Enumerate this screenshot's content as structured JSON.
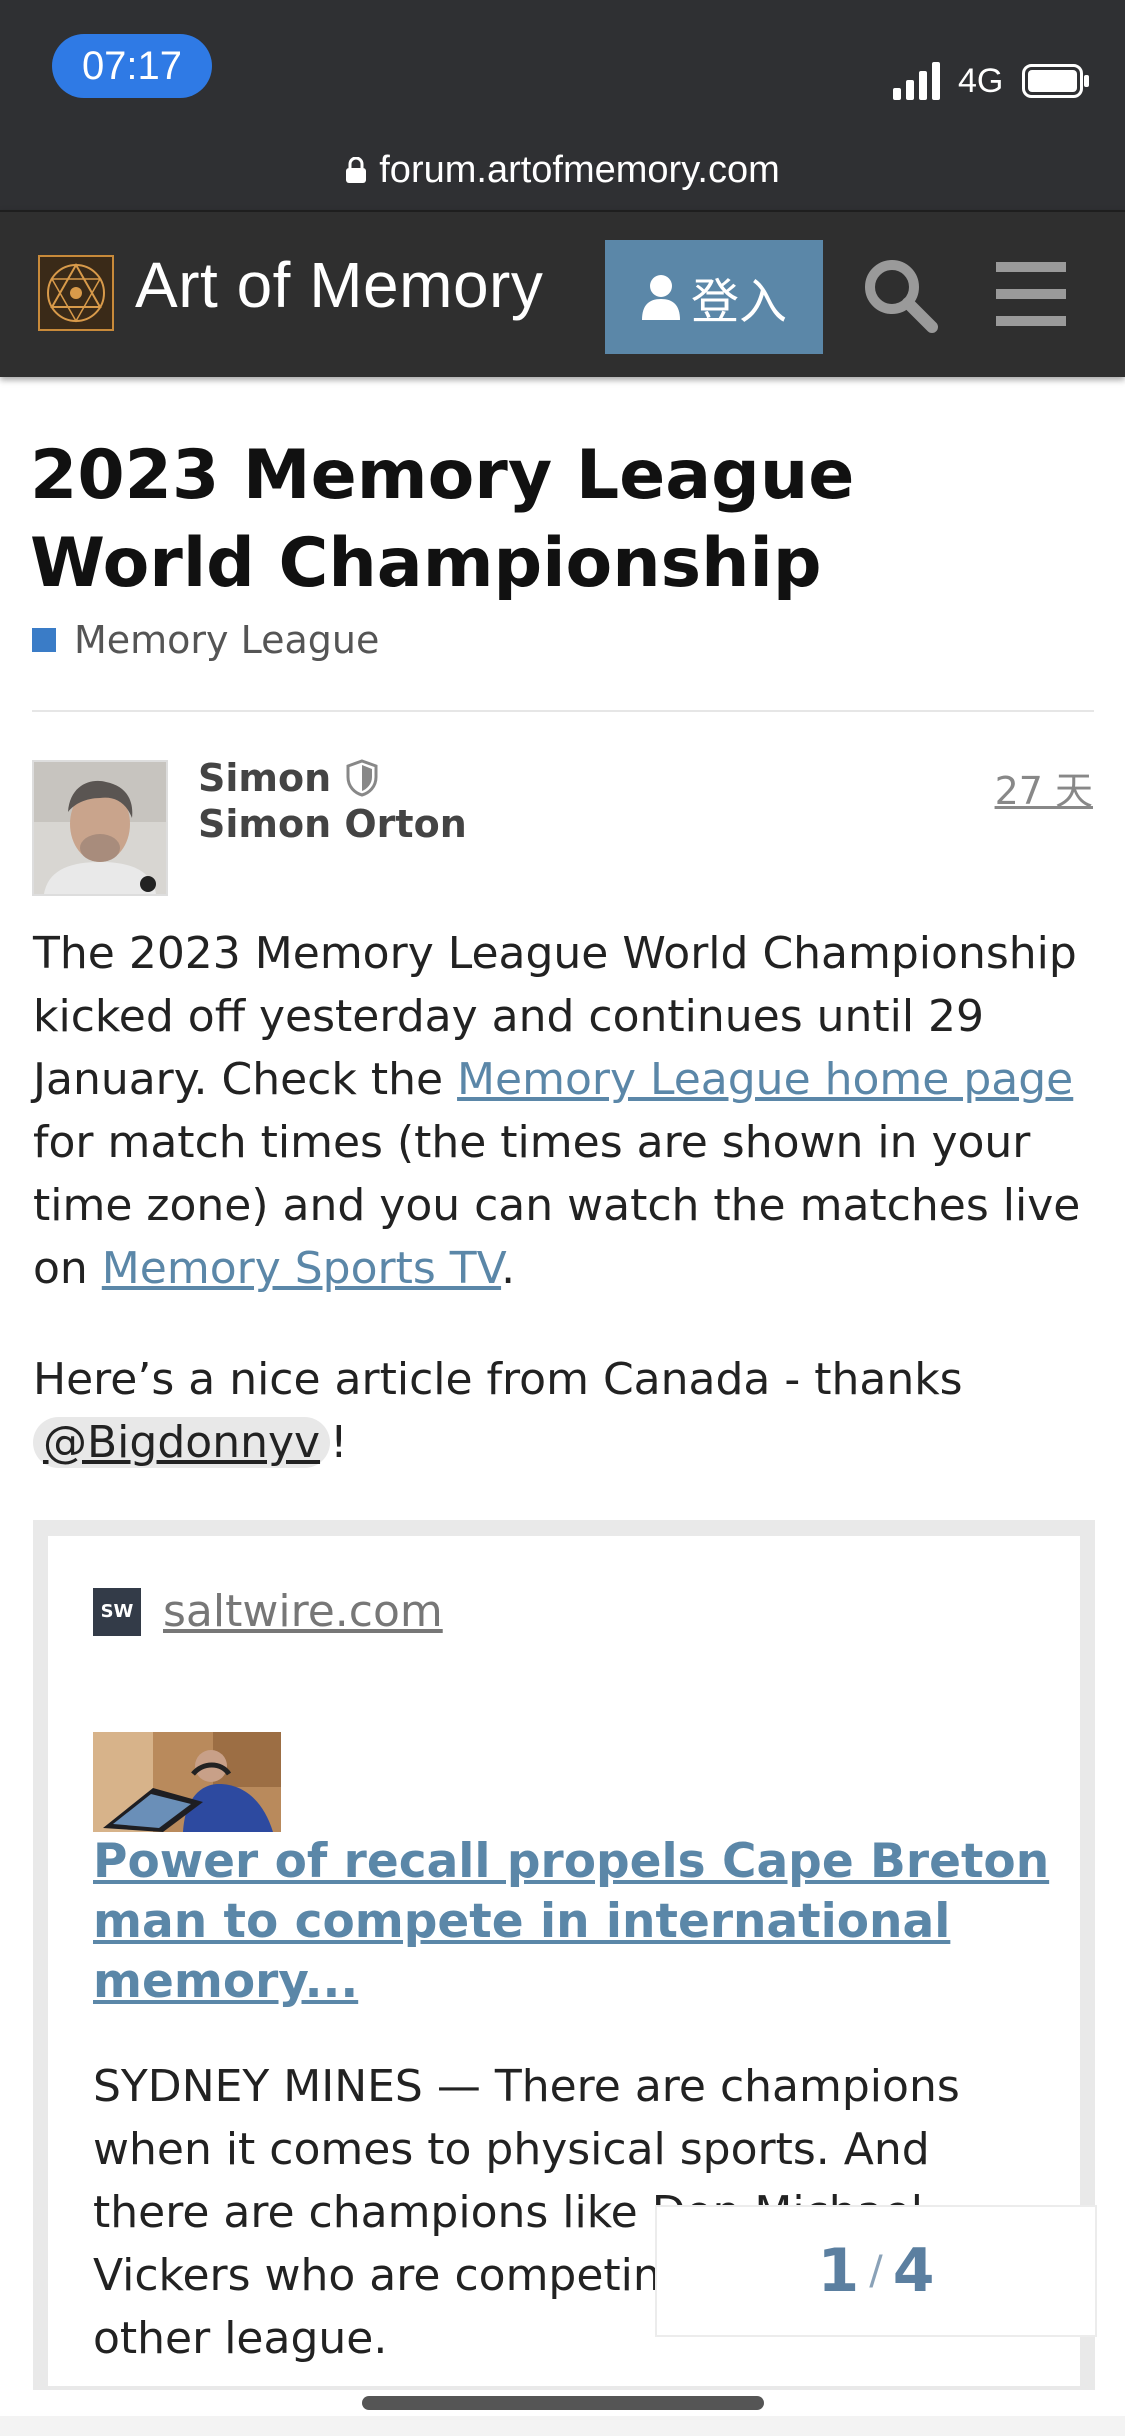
{
  "status_bar": {
    "time": "07:17",
    "network": "4G"
  },
  "browser": {
    "url": "forum.artofmemory.com"
  },
  "header": {
    "site_name": "Art of Memory",
    "login_label": "登入"
  },
  "topic": {
    "title": "2023 Memory League World Championship",
    "category": "Memory League",
    "category_color": "#3a7cc7"
  },
  "post": {
    "username": "Simon",
    "full_name": "Simon Orton",
    "date": "27 天",
    "paragraph1": {
      "part1": "The 2023 Memory League World Championship kicked off yesterday and continues until 29 January. Check the ",
      "link1": "Memory League home page",
      "part2": " for match times (the times are shown in your time zone) and you can watch the matches live on ",
      "link2": "Memory Sports TV",
      "part3": "."
    },
    "paragraph2": {
      "text": "Here’s a nice article from Canada - thanks ",
      "mention": "@Bigdonnyv",
      "end": "!"
    }
  },
  "onebox": {
    "favicon_text": "SW",
    "source": "saltwire.com",
    "title": "Power of recall propels Cape Breton man to compete in international memory...",
    "excerpt": "SYDNEY MINES — There are champions when it comes to physical sports. And there are champions like Don Michael Vickers who are competing in a whole other league."
  },
  "progress": {
    "current": "1",
    "total": "4"
  }
}
